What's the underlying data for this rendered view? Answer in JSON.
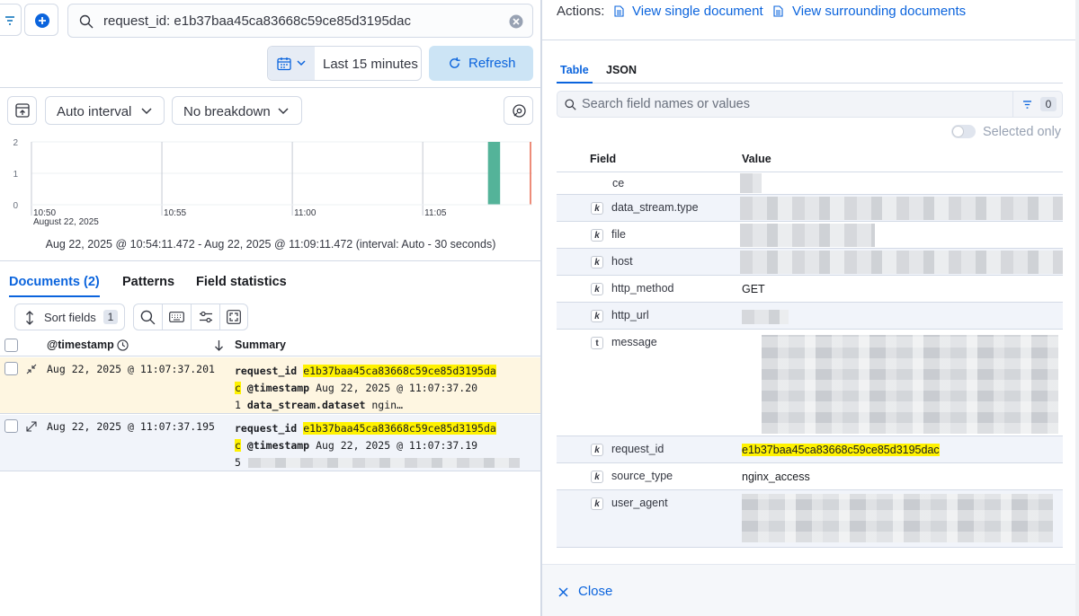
{
  "query": {
    "text": "request_id: e1b37baa45ca83668c59ce85d3195dac",
    "time_range": "Last 15 minutes",
    "refresh_label": "Refresh"
  },
  "histogram": {
    "interval_label": "Auto interval",
    "breakdown_label": "No breakdown",
    "y_ticks": [
      "2",
      "1",
      "0"
    ],
    "x_ticks": [
      "10:50",
      "10:55",
      "11:00",
      "11:05"
    ],
    "x_date": "August 22, 2025",
    "range_caption": "Aug 22, 2025 @ 10:54:11.472 - Aug 22, 2025 @ 11:09:11.472 (interval: Auto - 30 seconds)",
    "bar_color": "#54b399",
    "now_marker_color": "#e7664c"
  },
  "chart_data": {
    "type": "bar",
    "x": [
      "11:07:30"
    ],
    "values": [
      2
    ],
    "ylim": [
      0,
      2
    ]
  },
  "tabs": {
    "documents": "Documents (2)",
    "patterns": "Patterns",
    "field_statistics": "Field statistics"
  },
  "toolbar": {
    "sort_fields": "Sort fields",
    "sort_count": "1"
  },
  "table": {
    "col_timestamp": "@timestamp",
    "col_summary": "Summary",
    "rows": [
      {
        "timestamp": "Aug 22, 2025 @ 11:07:37.201",
        "field1": "request_id",
        "value1": "e1b37baa45ca83668c59ce85d3195da",
        "value1_wrap": "c",
        "field2": "@timestamp",
        "value2": "Aug 22, 2025 @ 11:07:37.20",
        "line3_prefix": "1",
        "field3": "data_stream.dataset",
        "value3": "ngin…"
      },
      {
        "timestamp": "Aug 22, 2025 @ 11:07:37.195",
        "field1": "request_id",
        "value1": "e1b37baa45ca83668c59ce85d3195da",
        "value1_wrap": "c",
        "field2": "@timestamp",
        "value2": "Aug 22, 2025 @ 11:07:37.19",
        "line3_prefix": "5"
      }
    ]
  },
  "flyout": {
    "actions_label": "Actions:",
    "view_single": "View single document",
    "view_surrounding": "View surrounding documents",
    "tab_table": "Table",
    "tab_json": "JSON",
    "search_placeholder": "Search field names or values",
    "filter_count": "0",
    "selected_only": "Selected only",
    "col_field": "Field",
    "col_value": "Value",
    "close_label": "Close",
    "fields": [
      {
        "icon": "k",
        "name": "ce",
        "value": ""
      },
      {
        "icon": "k",
        "name": "data_stream.type",
        "value": ""
      },
      {
        "icon": "k",
        "name": "file",
        "value": ""
      },
      {
        "icon": "k",
        "name": "host",
        "value": ""
      },
      {
        "icon": "k",
        "name": "http_method",
        "value": "GET"
      },
      {
        "icon": "k",
        "name": "http_url",
        "value": ""
      },
      {
        "icon": "t",
        "name": "message",
        "value": ""
      },
      {
        "icon": "k",
        "name": "request_id",
        "value": "e1b37baa45ca83668c59ce85d3195dac"
      },
      {
        "icon": "k",
        "name": "source_type",
        "value": "nginx_access"
      },
      {
        "icon": "k",
        "name": "user_agent",
        "value": ""
      }
    ]
  }
}
